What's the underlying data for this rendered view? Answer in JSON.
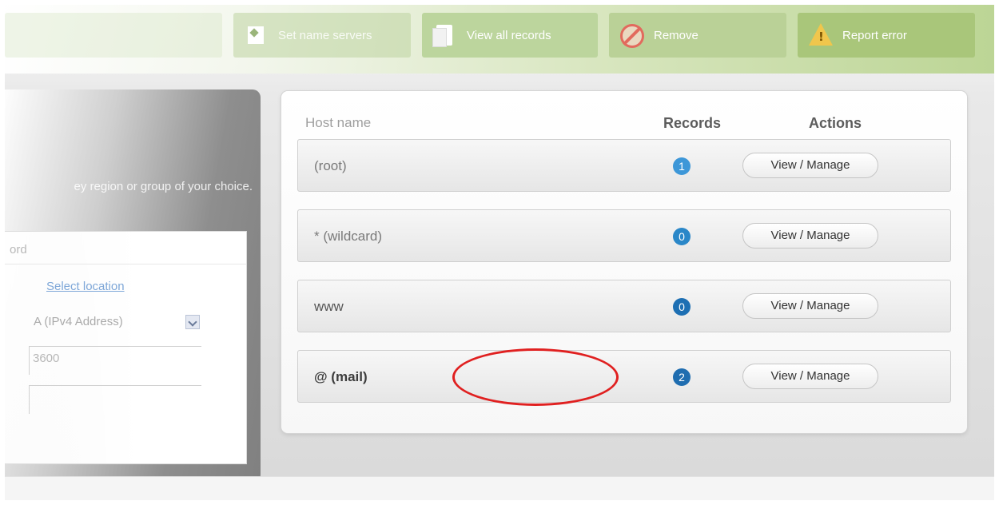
{
  "toolbar": {
    "set_name_servers": "Set name servers",
    "view_all_records": "View all records",
    "remove": "Remove",
    "report_error": "Report error"
  },
  "left_panel": {
    "note": "ey region or group of your choice.",
    "form_title": "ord",
    "location_link": "Select location",
    "record_type": "A (IPv4 Address)",
    "ttl": "3600",
    "value": ""
  },
  "table": {
    "headers": {
      "host": "Host name",
      "records": "Records",
      "actions": "Actions"
    },
    "rows": [
      {
        "host": "(root)",
        "count": "1",
        "action": "View / Manage",
        "badge_color": "#3d97d8"
      },
      {
        "host": "* (wildcard)",
        "count": "0",
        "action": "View / Manage",
        "badge_color": "#2a87c8"
      },
      {
        "host": "www",
        "count": "0",
        "action": "View / Manage",
        "badge_color": "#1d6fb3"
      },
      {
        "host": "@ (mail)",
        "count": "2",
        "action": "View / Manage",
        "badge_color": "#1f6db0"
      }
    ]
  },
  "colors": {
    "highlight": "#e02020",
    "toolbar_green": "#a9c67a"
  }
}
